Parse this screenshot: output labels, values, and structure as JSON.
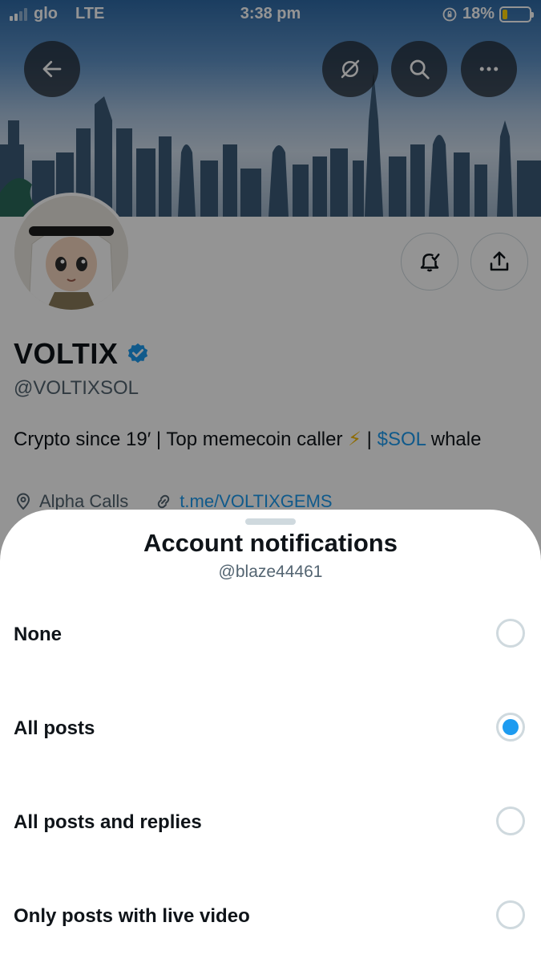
{
  "status_bar": {
    "carrier": "glo",
    "network": "LTE",
    "time": "3:38 pm",
    "battery_percent": "18%",
    "battery_level": 0.18
  },
  "profile": {
    "display_name": "VOLTIX",
    "handle": "@VOLTIXSOL",
    "bio": {
      "text_before": "Crypto since 19′ | Top memecoin caller",
      "emoji": "⚡",
      "separator": " | ",
      "cashtag": "$SOL",
      "text_after": " whale"
    },
    "location": "Alpha Calls",
    "link": "t.me/VOLTIXGEMS"
  },
  "icons": {
    "back": "arrow-left-icon",
    "grok": "grok-icon",
    "search": "search-icon",
    "more": "more-icon",
    "notifications": "bell-check-icon",
    "share": "share-icon",
    "location": "location-pin-icon",
    "link": "link-icon",
    "verified": "verified-badge-icon"
  },
  "sheet": {
    "title": "Account notifications",
    "subtitle": "@blaze44461",
    "options": [
      {
        "label": "None",
        "selected": false
      },
      {
        "label": "All posts",
        "selected": true
      },
      {
        "label": "All posts and replies",
        "selected": false
      },
      {
        "label": "Only posts with live video",
        "selected": false
      }
    ]
  },
  "colors": {
    "accent": "#1d9bf0",
    "text_primary": "#0f1419",
    "text_secondary": "#536471",
    "battery_fill": "#ffd60a"
  }
}
